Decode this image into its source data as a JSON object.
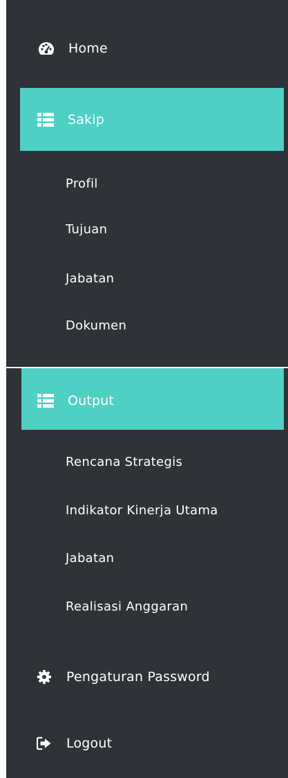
{
  "menu": {
    "home": {
      "label": "Home",
      "icon": "dashboard-icon"
    },
    "sakip": {
      "label": "Sakip",
      "icon": "table-list-icon",
      "items": [
        "Profil",
        "Tujuan",
        "Jabatan",
        "Dokumen"
      ]
    },
    "output": {
      "label": "Output",
      "icon": "table-list-icon",
      "items": [
        "Rencana Strategis",
        "Indikator Kinerja Utama",
        "Jabatan",
        "Realisasi Anggaran"
      ]
    },
    "password": {
      "label": "Pengaturan Password",
      "icon": "gear-icon"
    },
    "logout": {
      "label": "Logout",
      "icon": "logout-icon"
    }
  },
  "colors": {
    "sidebar_bg": "#2f3237",
    "active_bg": "#4ed0c4",
    "text": "#ffffff"
  }
}
